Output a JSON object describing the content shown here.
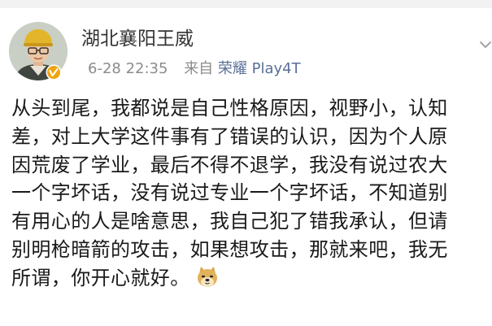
{
  "user": {
    "name": "湖北襄阳王威",
    "avatar_icon": "avatar-photo",
    "verified_icon": "verified-badge-icon",
    "verified_color": "#f0a40c"
  },
  "meta": {
    "time": "6-28 22:35",
    "source_label": "来自",
    "device": "荣耀 Play4T"
  },
  "post": {
    "lines": [
      "从头到尾，我都说是自己性格原因，视野小，认知",
      "差，对上大学这件事有了错误的认识，因为个人原",
      "因荒废了学业，最后不得不退学，我没有说过农大",
      "一个字坏话，没有说过专业一个字坏话，不知道别",
      "有用心的人是啥意思，我自己犯了错我承认，但请",
      "别明枪暗箭的攻击，如果想攻击，那就来吧，我无",
      "所谓，你开心就好。"
    ],
    "emoji_icon": "doge-emoji-icon"
  },
  "colors": {
    "link": "#5a6f96",
    "meta_text": "#8c8c8c",
    "body_text": "#1a1a1a",
    "background": "#ffffff"
  }
}
